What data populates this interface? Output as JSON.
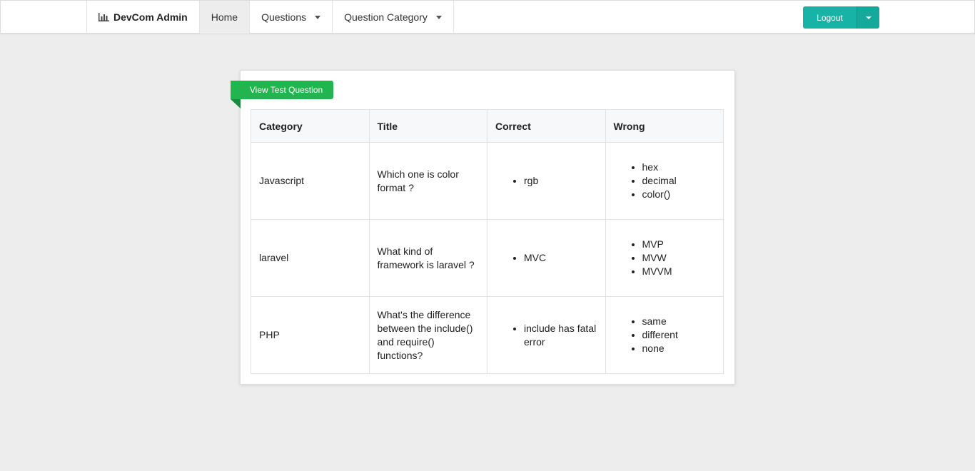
{
  "navbar": {
    "brand": "DevCom Admin",
    "brand_icon": "bar-chart-icon",
    "items": [
      {
        "label": "Home",
        "active": true
      },
      {
        "label": "Questions",
        "dropdown": true
      },
      {
        "label": "Question Category",
        "dropdown": true
      }
    ],
    "logout_label": "Logout",
    "accent_color": "#17b3a6"
  },
  "card": {
    "ribbon_label": "View Test Question",
    "ribbon_color": "#22b44e"
  },
  "table": {
    "headers": [
      "Category",
      "Title",
      "Correct",
      "Wrong"
    ],
    "rows": [
      {
        "category": "Javascript",
        "title": "Which one is color format ?",
        "correct": [
          "rgb"
        ],
        "wrong": [
          "hex",
          "decimal",
          "color()"
        ]
      },
      {
        "category": "laravel",
        "title": "What kind of framework is laravel ?",
        "correct": [
          "MVC"
        ],
        "wrong": [
          "MVP",
          "MVW",
          "MVVM"
        ]
      },
      {
        "category": "PHP",
        "title": "What's the difference between the include() and require() functions?",
        "correct": [
          "include has fatal error"
        ],
        "wrong": [
          "same",
          "different",
          "none"
        ]
      }
    ]
  }
}
